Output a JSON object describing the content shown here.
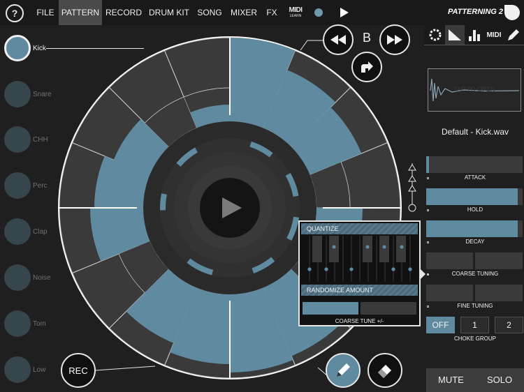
{
  "menu": {
    "help": "?",
    "items": [
      "FILE",
      "PATTERN",
      "RECORD",
      "DRUM KIT",
      "SONG",
      "MIXER",
      "FX"
    ],
    "active": "PATTERN",
    "midi_learn_big": "MIDI",
    "midi_learn_small": "LEARN",
    "app_title": "PATTERNING 2"
  },
  "tracks": [
    {
      "label": "Kick",
      "selected": true
    },
    {
      "label": "Snare",
      "selected": false
    },
    {
      "label": "CHH",
      "selected": false
    },
    {
      "label": "Perc",
      "selected": false
    },
    {
      "label": "Clap",
      "selected": false
    },
    {
      "label": "Noise",
      "selected": false
    },
    {
      "label": "Tom",
      "selected": false
    },
    {
      "label": "Low",
      "selected": false
    }
  ],
  "pattern": {
    "bank_letter": "B",
    "rec_label": "REC"
  },
  "quantize": {
    "title": "QUANTIZE",
    "randomize_title": "RANDOMIZE AMOUNT",
    "coarse_label": "COARSE TUNE +/-",
    "randomize_level": 0.5
  },
  "sound": {
    "tabs": [
      "circle-icon",
      "envelope-icon",
      "levels-icon",
      "midi-icon",
      "pencil-icon"
    ],
    "active_tab": "envelope-icon",
    "waveform_hint": "TAP TO OPEN",
    "sample_name": "Default - Kick.wav",
    "controls": [
      {
        "label": "ATTACK",
        "level": 0.03
      },
      {
        "label": "HOLD",
        "level": 0.95
      },
      {
        "label": "DECAY",
        "level": 0.95
      },
      {
        "label": "COARSE TUNING",
        "level": 0.5
      },
      {
        "label": "FINE TUNING",
        "level": 0.5
      }
    ],
    "choke": {
      "buttons": [
        "OFF",
        "1",
        "2"
      ],
      "selected": "OFF",
      "label": "CHOKE GROUP"
    },
    "mute_label": "MUTE",
    "solo_label": "SOLO"
  },
  "colors": {
    "accent": "#5f8aa0",
    "cell": "#3a3a3a",
    "background": "#1f1f1f"
  }
}
